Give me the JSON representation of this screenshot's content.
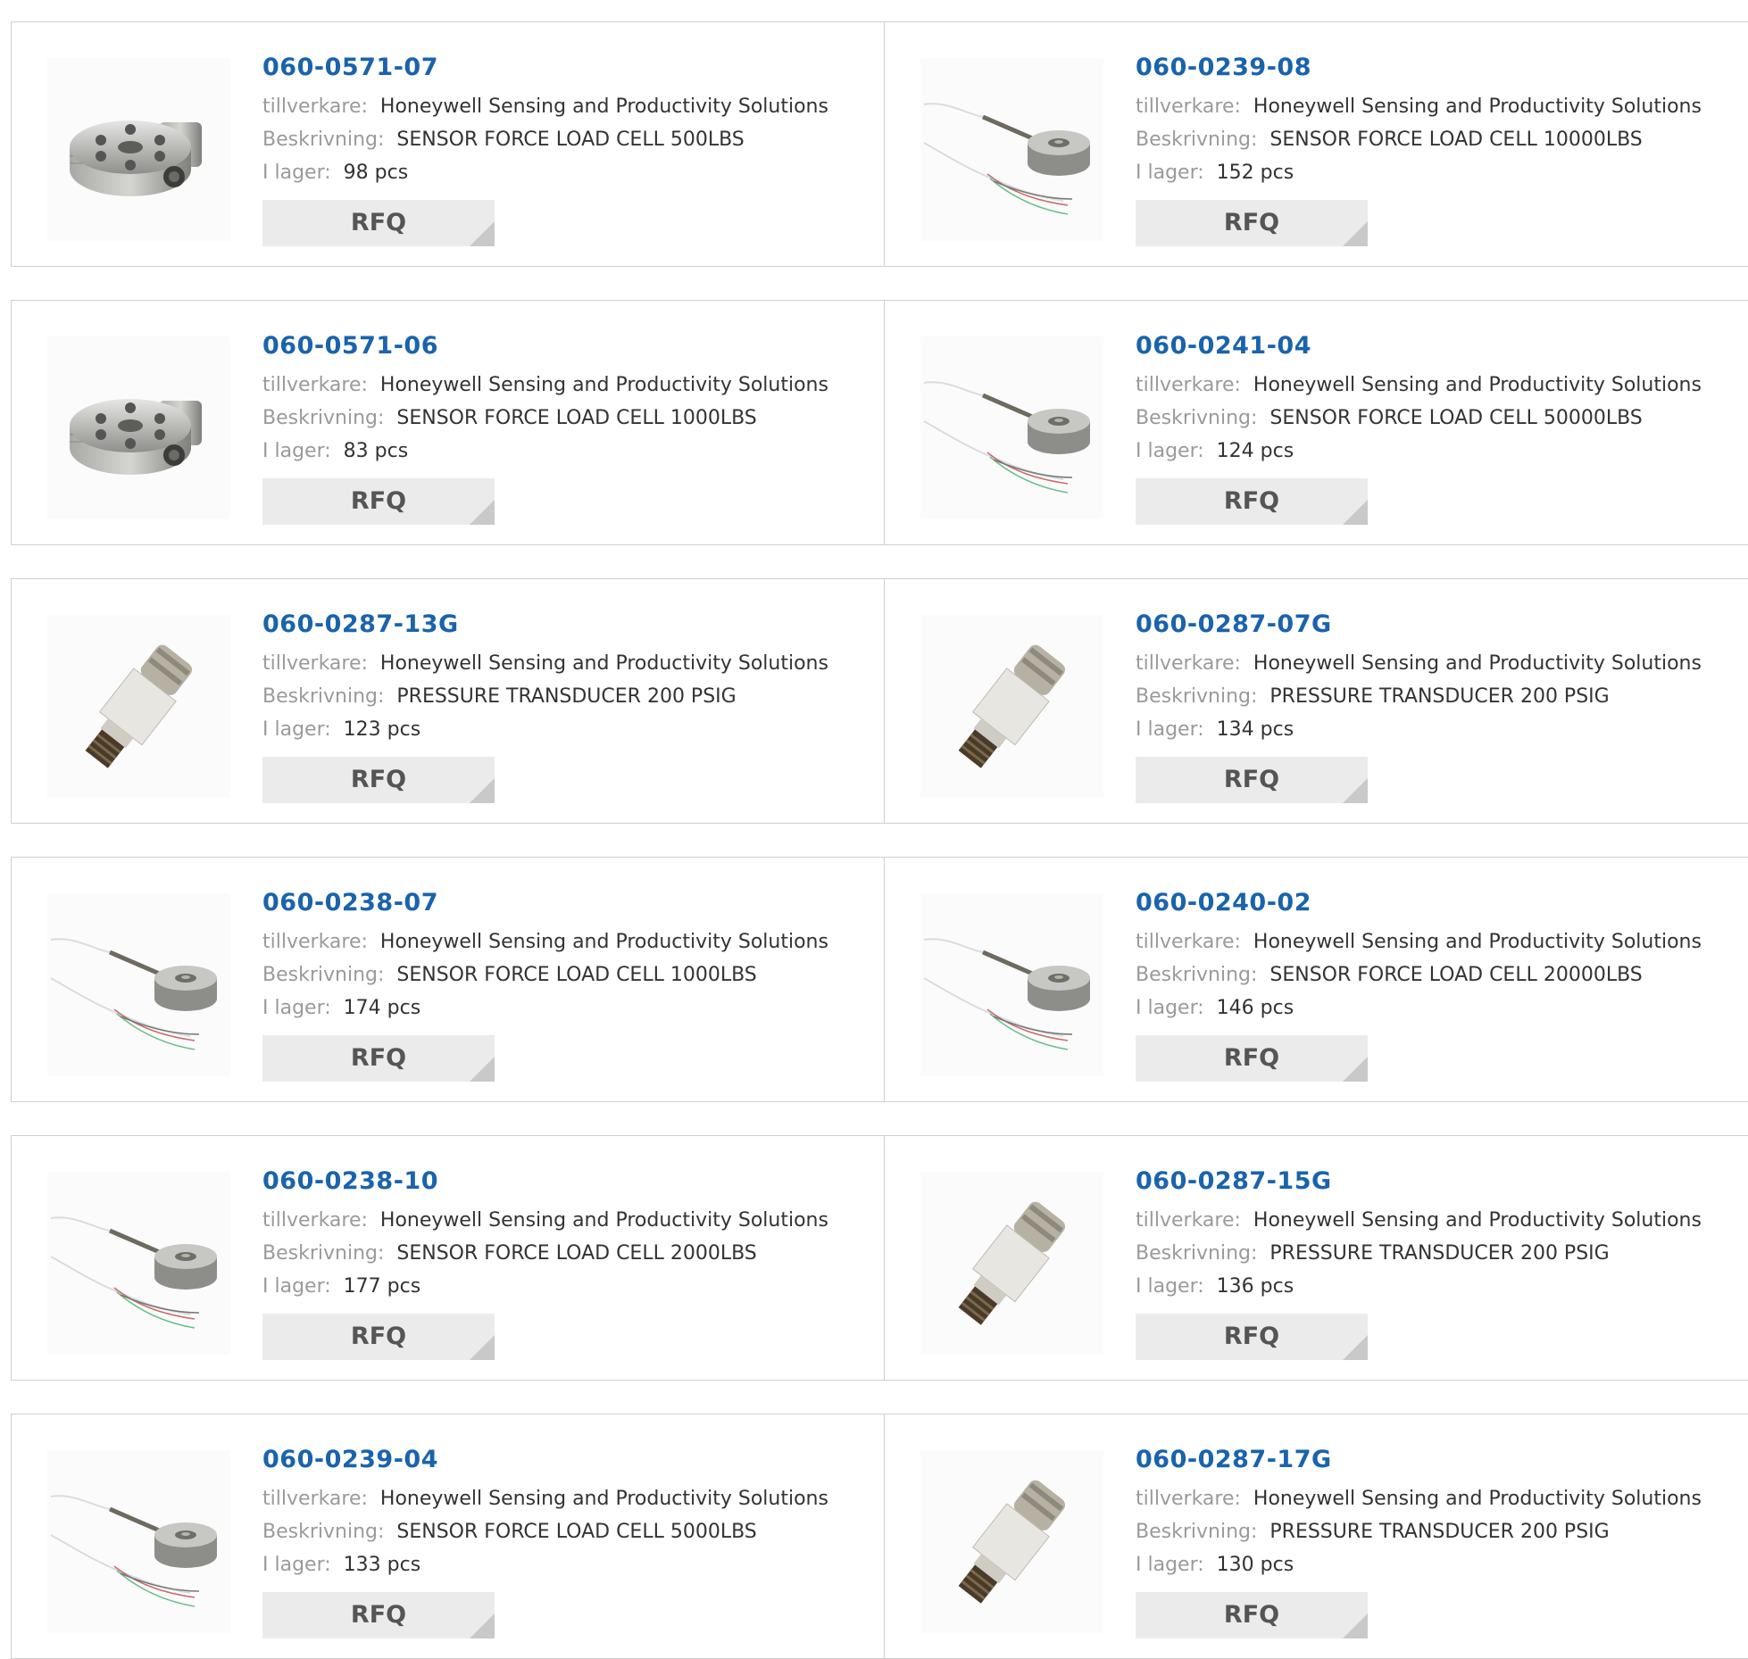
{
  "labels": {
    "manufacturer": "tillverkare:",
    "description": "Beskrivning:",
    "stock": "I lager:",
    "rfq": "RFQ"
  },
  "products": [
    {
      "part": "060-0571-07",
      "manufacturer": "Honeywell Sensing and Productivity Solutions",
      "description": "SENSOR FORCE LOAD CELL 500LBS",
      "stock": "98 pcs",
      "image": "pancake-load-cell"
    },
    {
      "part": "060-0239-08",
      "manufacturer": "Honeywell Sensing and Productivity Solutions",
      "description": "SENSOR FORCE LOAD CELL 10000LBS",
      "stock": "152 pcs",
      "image": "button-load-cell"
    },
    {
      "part": "060-0571-06",
      "manufacturer": "Honeywell Sensing and Productivity Solutions",
      "description": "SENSOR FORCE LOAD CELL 1000LBS",
      "stock": "83 pcs",
      "image": "pancake-load-cell"
    },
    {
      "part": "060-0241-04",
      "manufacturer": "Honeywell Sensing and Productivity Solutions",
      "description": "SENSOR FORCE LOAD CELL 50000LBS",
      "stock": "124 pcs",
      "image": "button-load-cell"
    },
    {
      "part": "060-0287-13G",
      "manufacturer": "Honeywell Sensing and Productivity Solutions",
      "description": "PRESSURE TRANSDUCER 200 PSIG",
      "stock": "123 pcs",
      "image": "pressure-transducer"
    },
    {
      "part": "060-0287-07G",
      "manufacturer": "Honeywell Sensing and Productivity Solutions",
      "description": "PRESSURE TRANSDUCER 200 PSIG",
      "stock": "134 pcs",
      "image": "pressure-transducer"
    },
    {
      "part": "060-0238-07",
      "manufacturer": "Honeywell Sensing and Productivity Solutions",
      "description": "SENSOR FORCE LOAD CELL 1000LBS",
      "stock": "174 pcs",
      "image": "button-load-cell"
    },
    {
      "part": "060-0240-02",
      "manufacturer": "Honeywell Sensing and Productivity Solutions",
      "description": "SENSOR FORCE LOAD CELL 20000LBS",
      "stock": "146 pcs",
      "image": "button-load-cell"
    },
    {
      "part": "060-0238-10",
      "manufacturer": "Honeywell Sensing and Productivity Solutions",
      "description": "SENSOR FORCE LOAD CELL 2000LBS",
      "stock": "177 pcs",
      "image": "button-load-cell"
    },
    {
      "part": "060-0287-15G",
      "manufacturer": "Honeywell Sensing and Productivity Solutions",
      "description": "PRESSURE TRANSDUCER 200 PSIG",
      "stock": "136 pcs",
      "image": "pressure-transducer"
    },
    {
      "part": "060-0239-04",
      "manufacturer": "Honeywell Sensing and Productivity Solutions",
      "description": "SENSOR FORCE LOAD CELL 5000LBS",
      "stock": "133 pcs",
      "image": "button-load-cell"
    },
    {
      "part": "060-0287-17G",
      "manufacturer": "Honeywell Sensing and Productivity Solutions",
      "description": "PRESSURE TRANSDUCER 200 PSIG",
      "stock": "130 pcs",
      "image": "pressure-transducer"
    }
  ],
  "colors": {
    "part_number": "#1a63ad",
    "label": "#9a9a9a",
    "value": "#333333",
    "button_bg": "#ebebeb"
  }
}
